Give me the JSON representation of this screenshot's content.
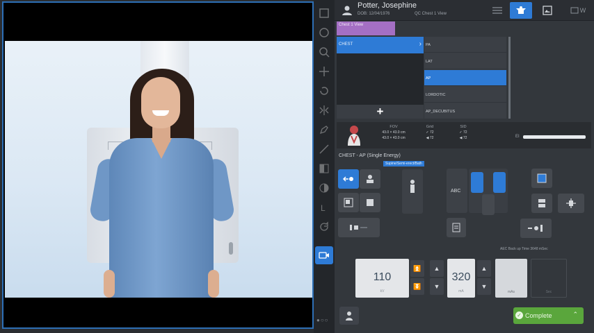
{
  "patient": {
    "name": "Potter, Josephine",
    "dob": "DOB: 12/04/1976",
    "procedure": "QC Chest 1 View"
  },
  "header_buttons": [
    {
      "icon": "list-icon",
      "active": false
    },
    {
      "icon": "acquisition-icon",
      "active": true
    },
    {
      "icon": "image-review-icon",
      "active": false
    },
    {
      "icon": "worklist-icon",
      "label": "W",
      "active": false
    }
  ],
  "procedure_tab": "Chest 1 View",
  "study": {
    "selected": "CHEST",
    "chevron": "›"
  },
  "views": [
    {
      "label": "PA",
      "selected": false
    },
    {
      "label": "LAT",
      "selected": false
    },
    {
      "label": "AP",
      "selected": true
    },
    {
      "label": "LORDOTIC",
      "selected": false
    },
    {
      "label": "AP_DECUBITUS",
      "selected": false
    }
  ],
  "add_label": "+",
  "params": {
    "fov_label": "FOV",
    "fov_value": "43.0 × 43.0 cm",
    "fov_value2": "43.0 × 43.0 cm",
    "grid_label": "Grid",
    "grid_value": "✓ 72",
    "grid_value2": "◀ 72",
    "sid_label": "SID",
    "sid_value": "✓ 72",
    "sid_value2": "◀ 72",
    "ei_label": "EI"
  },
  "exam": {
    "title": "CHEST - AP (Single Energy)",
    "tag": "Supine/Semi-erect/Bath"
  },
  "aec_text": "AEC Back up Time 3648 mSec",
  "technique": {
    "kv": "110",
    "kv_unit": "kV",
    "ma": "320",
    "ma_unit": "mA",
    "mas_unit": "mAs",
    "sec_unit": "Sec"
  },
  "complete_label": "Complete",
  "colors": {
    "accent": "#2e7bd6",
    "complete": "#5aa63c",
    "procedure_tab": "#a46fc4"
  }
}
